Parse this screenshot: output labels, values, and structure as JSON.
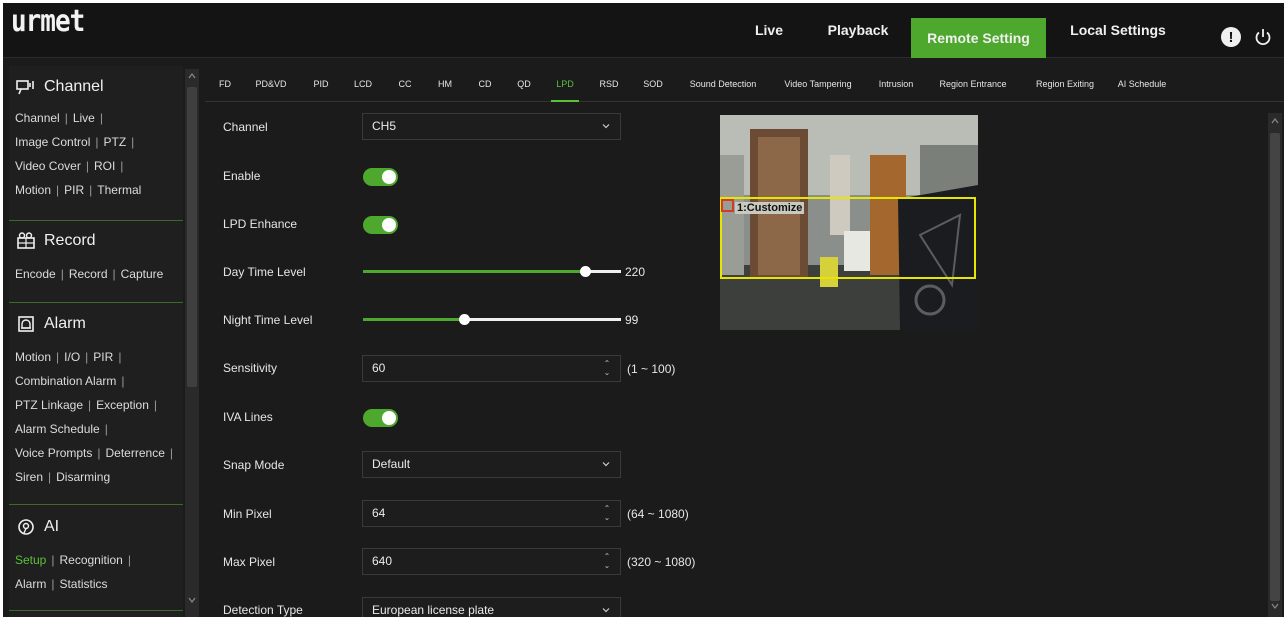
{
  "logo": "urmet",
  "nav": {
    "live": "Live",
    "playback": "Playback",
    "remote_setting": "Remote Setting",
    "local_settings": "Local Settings"
  },
  "top_icons": [
    "alert-icon",
    "power-icon"
  ],
  "accent_color": "#4fa82e",
  "sidebar": {
    "channel": {
      "title": "Channel",
      "links": [
        [
          "Channel",
          "Live"
        ],
        [
          "Image Control",
          "PTZ"
        ],
        [
          "Video Cover",
          "ROI"
        ],
        [
          "Motion",
          "PIR",
          "Thermal"
        ]
      ]
    },
    "record": {
      "title": "Record",
      "links": [
        [
          "Encode",
          "Record",
          "Capture"
        ]
      ]
    },
    "alarm": {
      "title": "Alarm",
      "links": [
        [
          "Motion",
          "I/O",
          "PIR"
        ],
        [
          "Combination Alarm"
        ],
        [
          "PTZ Linkage",
          "Exception"
        ],
        [
          "Alarm Schedule"
        ],
        [
          "Voice Prompts",
          "Deterrence"
        ],
        [
          "Siren",
          "Disarming"
        ]
      ]
    },
    "ai": {
      "title": "AI",
      "links": [
        [
          "Setup",
          "Recognition"
        ],
        [
          "Alarm",
          "Statistics"
        ]
      ],
      "active_link": "Setup"
    }
  },
  "tabs": [
    "FD",
    "PD&VD",
    "PID",
    "LCD",
    "CC",
    "HM",
    "CD",
    "QD",
    "LPD",
    "RSD",
    "SOD",
    "Sound Detection",
    "Video Tampering",
    "Intrusion",
    "Region Entrance",
    "Region Exiting",
    "AI Schedule"
  ],
  "active_tab": "LPD",
  "form": {
    "channel": {
      "label": "Channel",
      "value": "CH5"
    },
    "enable": {
      "label": "Enable",
      "on": true
    },
    "lpd_enhance": {
      "label": "LPD Enhance",
      "on": true
    },
    "day_time_level": {
      "label": "Day Time Level",
      "value": "220",
      "fraction": 0.86
    },
    "night_time_level": {
      "label": "Night Time Level",
      "value": "99",
      "fraction": 0.39
    },
    "sensitivity": {
      "label": "Sensitivity",
      "value": "60",
      "range": "(1 ~ 100)"
    },
    "iva_lines": {
      "label": "IVA Lines",
      "on": true
    },
    "snap_mode": {
      "label": "Snap Mode",
      "value": "Default"
    },
    "min_pixel": {
      "label": "Min Pixel",
      "value": "64",
      "range": "(64 ~ 1080)"
    },
    "max_pixel": {
      "label": "Max Pixel",
      "value": "640",
      "range": "(320 ~ 1080)"
    },
    "detection_type": {
      "label": "Detection Type",
      "value": "European license plate"
    }
  },
  "preview": {
    "region_label": "1:Customize",
    "region_color": "#e6e600"
  }
}
